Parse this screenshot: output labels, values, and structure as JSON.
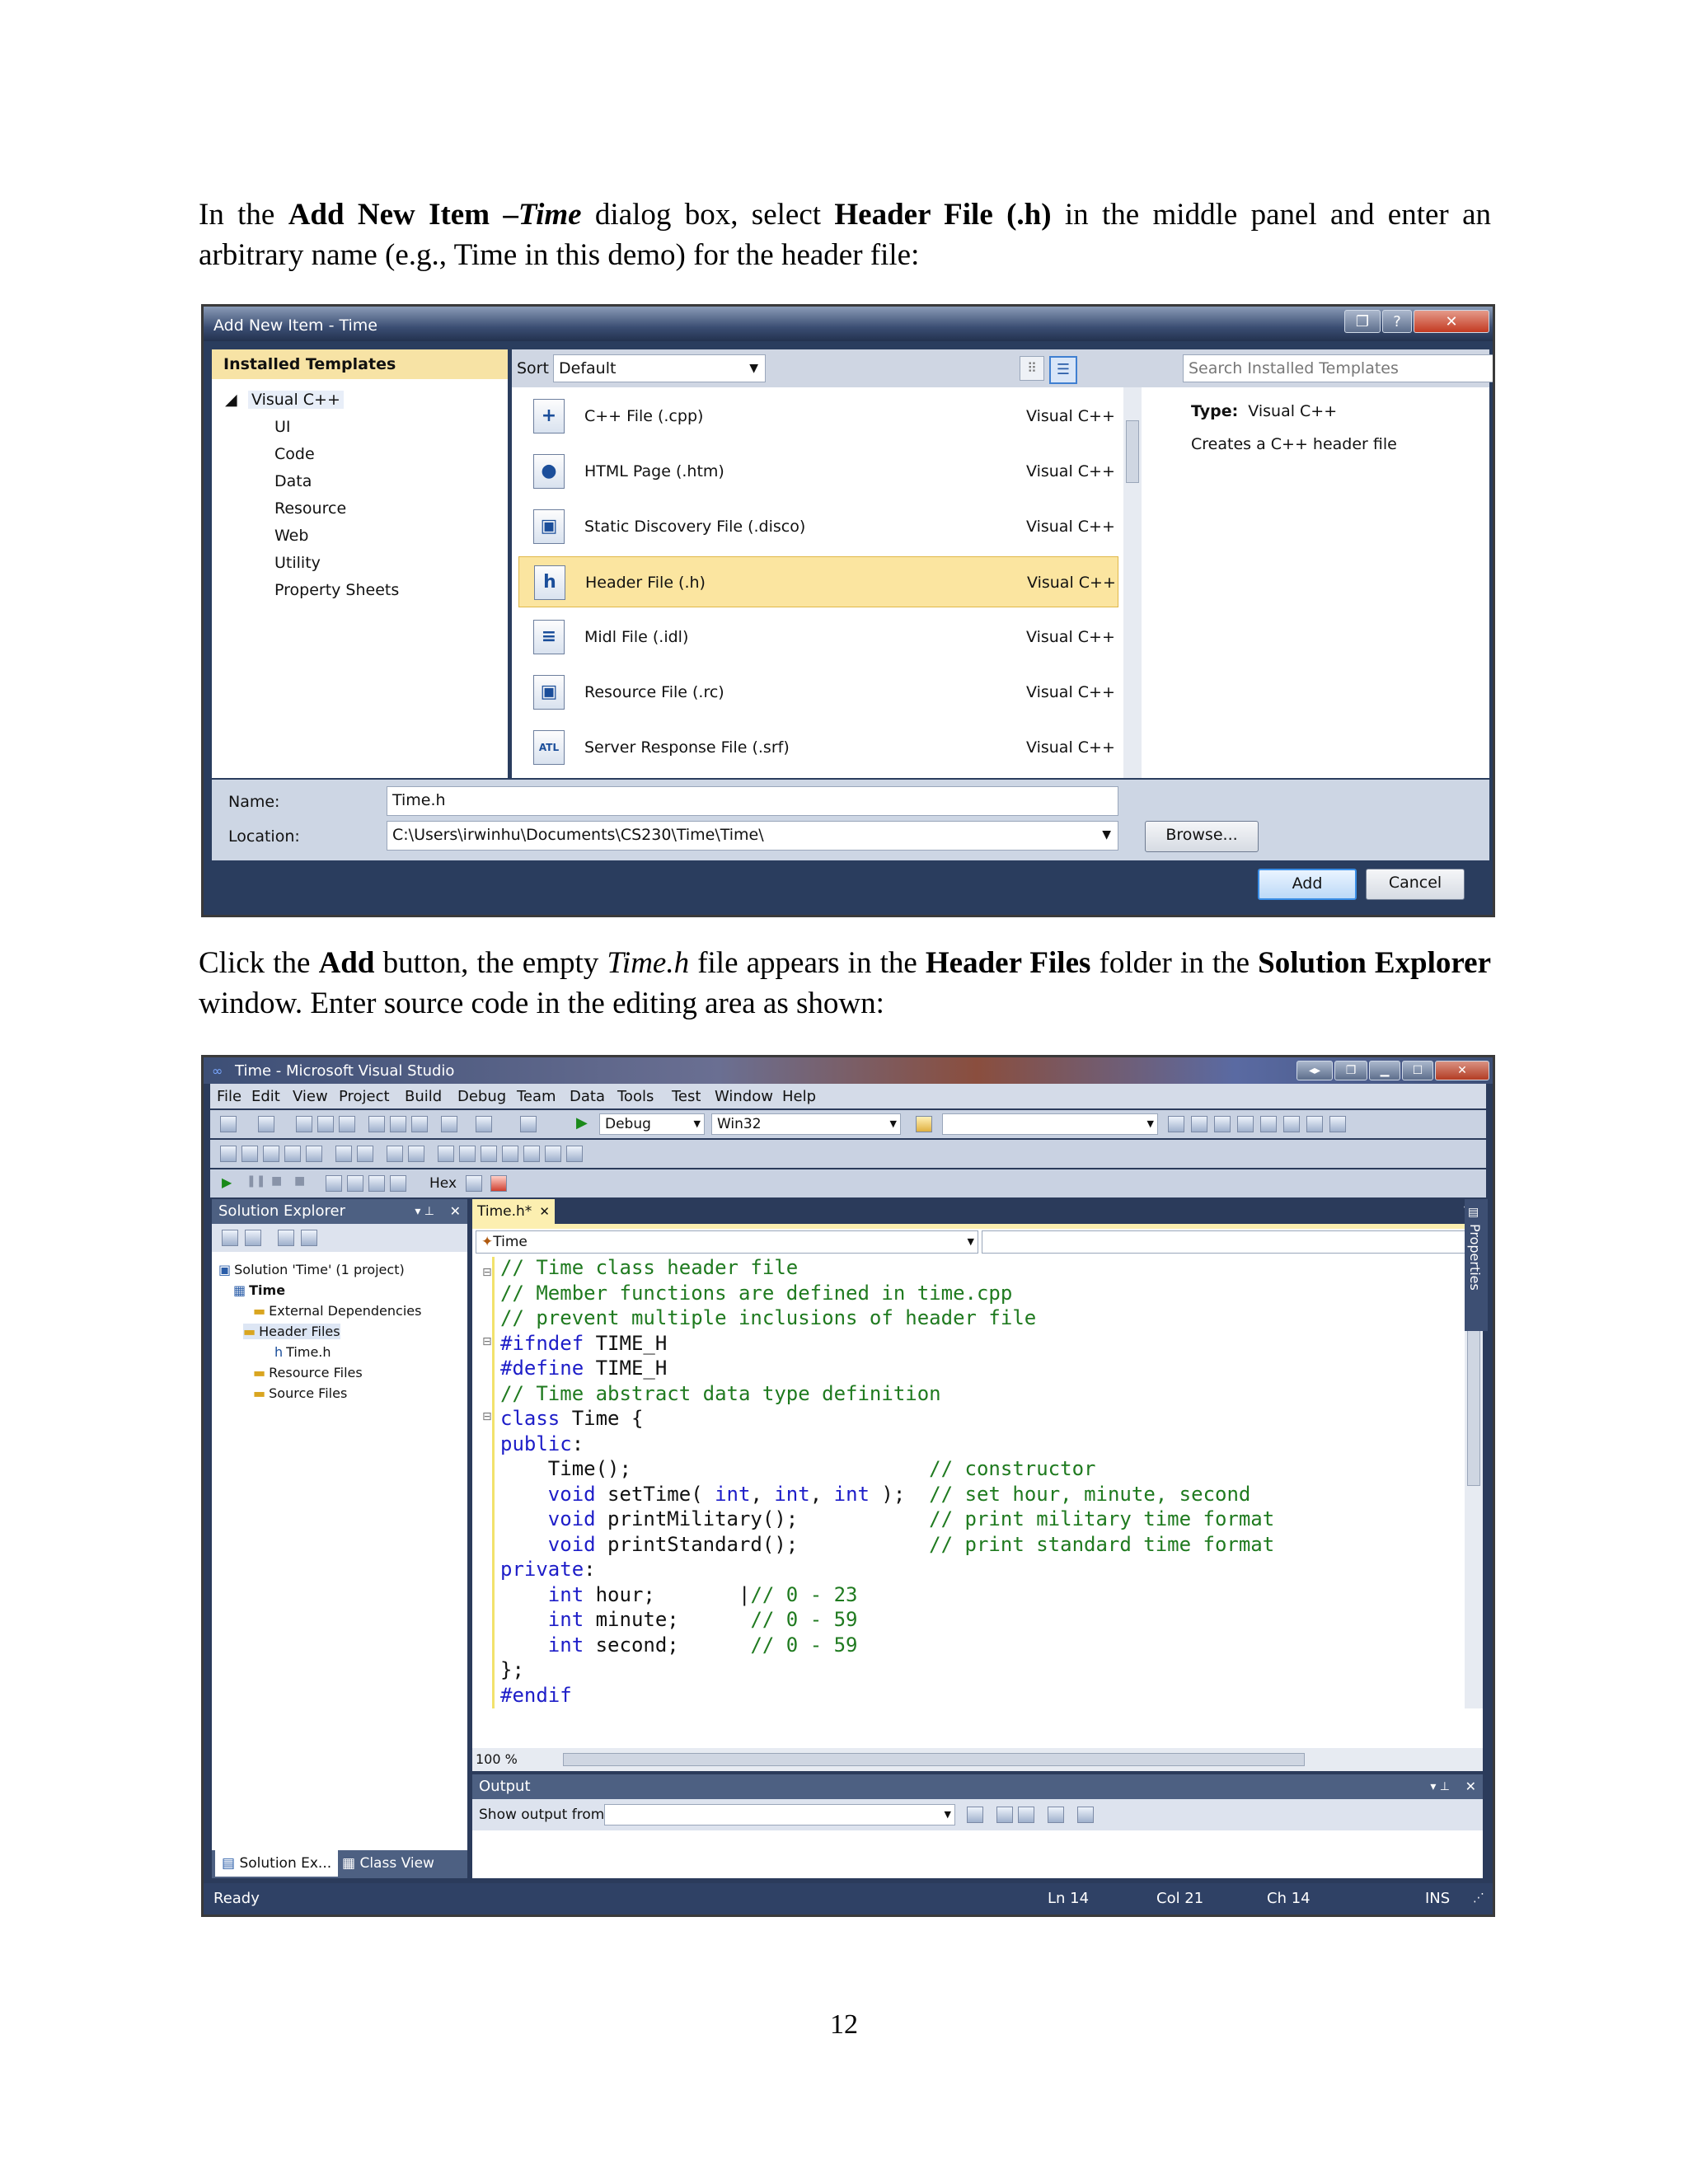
{
  "para1": {
    "t1": "In the ",
    "b1": "Add New Item",
    "t2": " –",
    "i1": "Time",
    "t3": " dialog box, select ",
    "b2": "Header File (.h)",
    "t4": " in the middle panel and enter an arbitrary name (e.g., Time in this demo) for the header file:"
  },
  "dialog": {
    "title": "Add New Item - Time",
    "installed_templates": "Installed Templates",
    "tree": [
      "Visual C++",
      "UI",
      "Code",
      "Data",
      "Resource",
      "Web",
      "Utility",
      "Property Sheets"
    ],
    "sort_by_label": "Sort by:",
    "sort_by_value": "Default",
    "search_placeholder": "Search Installed Templates",
    "templates": [
      {
        "name": "C++ File (.cpp)",
        "lang": "Visual C++",
        "icon": "cpp-file-icon",
        "glyph": "+"
      },
      {
        "name": "HTML Page (.htm)",
        "lang": "Visual C++",
        "icon": "html-page-icon",
        "glyph": "●"
      },
      {
        "name": "Static Discovery File (.disco)",
        "lang": "Visual C++",
        "icon": "disco-file-icon",
        "glyph": "▣"
      },
      {
        "name": "Header File (.h)",
        "lang": "Visual C++",
        "icon": "header-file-icon",
        "glyph": "h"
      },
      {
        "name": "Midl File (.idl)",
        "lang": "Visual C++",
        "icon": "midl-file-icon",
        "glyph": "≡"
      },
      {
        "name": "Resource File (.rc)",
        "lang": "Visual C++",
        "icon": "resource-file-icon",
        "glyph": "▣"
      },
      {
        "name": "Server Response File (.srf)",
        "lang": "Visual C++",
        "icon": "srf-file-icon",
        "glyph": "ATL"
      }
    ],
    "selected_index": 3,
    "type_label": "Type:",
    "type_value": "Visual C++",
    "description": "Creates a C++ header file",
    "name_label": "Name:",
    "name_value": "Time.h",
    "location_label": "Location:",
    "location_value": "C:\\Users\\irwinhu\\Documents\\CS230\\Time\\Time\\",
    "browse_label": "Browse...",
    "add_label": "Add",
    "cancel_label": "Cancel"
  },
  "para2": {
    "t1": "Click the ",
    "b1": "Add",
    "t2": " button, the empty ",
    "i1": "Time.h",
    "t3": " file appears in the ",
    "b2": "Header Files",
    "t4": " folder in the ",
    "b3": "Solution Explorer",
    "t5": " window.  Enter source code in the editing area as shown:"
  },
  "vs": {
    "title": "Time - Microsoft Visual Studio",
    "menu": [
      "File",
      "Edit",
      "View",
      "Project",
      "Build",
      "Debug",
      "Team",
      "Data",
      "Tools",
      "Test",
      "Window",
      "Help"
    ],
    "config": "Debug",
    "platform": "Win32",
    "hex_label": "Hex",
    "solution_explorer_title": "Solution Explorer",
    "solution_tree": [
      {
        "label": "Solution 'Time' (1 project)",
        "icon": "solution-icon"
      },
      {
        "label": "Time",
        "icon": "project-icon"
      },
      {
        "label": "External Dependencies",
        "icon": "folder-icon"
      },
      {
        "label": "Header Files",
        "icon": "folder-icon"
      },
      {
        "label": "Time.h",
        "icon": "header-file-icon"
      },
      {
        "label": "Resource Files",
        "icon": "folder-icon"
      },
      {
        "label": "Source Files",
        "icon": "folder-icon"
      }
    ],
    "bottom_tabs": [
      "Solution Ex...",
      "Class View"
    ],
    "editor_tab": "Time.h*",
    "nav_dropdown": "Time",
    "zoom": "100 %",
    "properties_label": "Properties",
    "code_lines": [
      [
        {
          "t": "// Time class header file",
          "c": "cm"
        }
      ],
      [
        {
          "t": "// Member functions are defined in time.cpp",
          "c": "cm"
        }
      ],
      [
        {
          "t": "// prevent multiple inclusions of header file",
          "c": "cm"
        }
      ],
      [
        {
          "t": "#ifndef",
          "c": "kw"
        },
        {
          "t": " TIME_H",
          "c": ""
        }
      ],
      [
        {
          "t": "#define",
          "c": "kw"
        },
        {
          "t": " TIME_H",
          "c": ""
        }
      ],
      [
        {
          "t": "// Time abstract data type definition",
          "c": "cm"
        }
      ],
      [
        {
          "t": "class",
          "c": "kw"
        },
        {
          "t": " Time {",
          "c": ""
        }
      ],
      [
        {
          "t": "public",
          "c": "kw"
        },
        {
          "t": ":",
          "c": ""
        }
      ],
      [
        {
          "t": "    Time();                         ",
          "c": ""
        },
        {
          "t": "// constructor",
          "c": "cm"
        }
      ],
      [
        {
          "t": "    ",
          "c": ""
        },
        {
          "t": "void",
          "c": "kw"
        },
        {
          "t": " setTime( ",
          "c": ""
        },
        {
          "t": "int",
          "c": "kw"
        },
        {
          "t": ", ",
          "c": ""
        },
        {
          "t": "int",
          "c": "kw"
        },
        {
          "t": ", ",
          "c": ""
        },
        {
          "t": "int",
          "c": "kw"
        },
        {
          "t": " );  ",
          "c": ""
        },
        {
          "t": "// set hour, minute, second",
          "c": "cm"
        }
      ],
      [
        {
          "t": "    ",
          "c": ""
        },
        {
          "t": "void",
          "c": "kw"
        },
        {
          "t": " printMilitary();           ",
          "c": ""
        },
        {
          "t": "// print military time format",
          "c": "cm"
        }
      ],
      [
        {
          "t": "    ",
          "c": ""
        },
        {
          "t": "void",
          "c": "kw"
        },
        {
          "t": " printStandard();           ",
          "c": ""
        },
        {
          "t": "// print standard time format",
          "c": "cm"
        }
      ],
      [
        {
          "t": "private",
          "c": "kw"
        },
        {
          "t": ":",
          "c": ""
        }
      ],
      [
        {
          "t": "    ",
          "c": ""
        },
        {
          "t": "int",
          "c": "kw"
        },
        {
          "t": " hour;       |",
          "c": ""
        },
        {
          "t": "// 0 - 23",
          "c": "cm"
        }
      ],
      [
        {
          "t": "    ",
          "c": ""
        },
        {
          "t": "int",
          "c": "kw"
        },
        {
          "t": " minute;      ",
          "c": ""
        },
        {
          "t": "// 0 - 59",
          "c": "cm"
        }
      ],
      [
        {
          "t": "    ",
          "c": ""
        },
        {
          "t": "int",
          "c": "kw"
        },
        {
          "t": " second;      ",
          "c": ""
        },
        {
          "t": "// 0 - 59",
          "c": "cm"
        }
      ],
      [
        {
          "t": "};",
          "c": ""
        }
      ],
      [
        {
          "t": "#endif",
          "c": "kw"
        }
      ]
    ],
    "output_title": "Output",
    "show_output_label": "Show output from:",
    "status": {
      "ready": "Ready",
      "ln": "Ln 14",
      "col": "Col 21",
      "ch": "Ch 14",
      "ins": "INS"
    }
  },
  "page_number": "12"
}
